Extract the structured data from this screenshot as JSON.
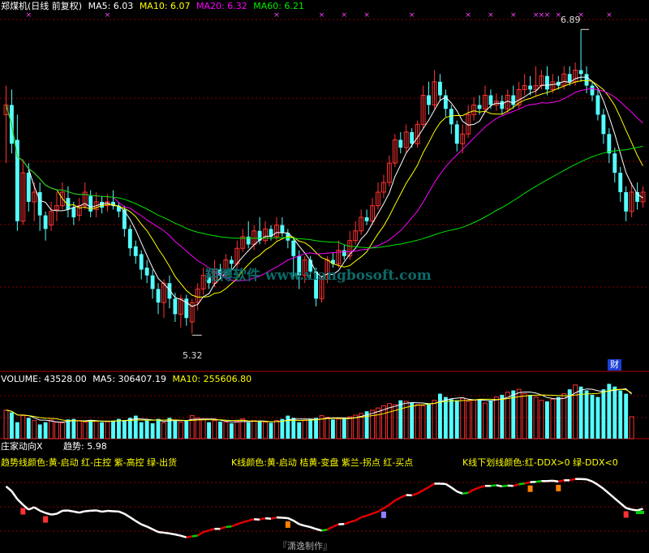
{
  "header": {
    "stock": "郑煤机(日线 前复权)",
    "ma5": "MA5: 6.03",
    "ma10": "MA10: 6.07",
    "ma20": "MA20: 6.32",
    "ma60": "MA60: 6.21"
  },
  "price_annotations": {
    "high": "6.89",
    "low": "5.32"
  },
  "watermark": "翔博软件 www.xiangbosoft.com",
  "badge_cai": "财",
  "volume_header": {
    "title": "VOLUME: 43528.00",
    "ma5": "MA5: 306407.19",
    "ma10": "MA10: 255606.80"
  },
  "indicator_header": {
    "name": "庄家动向X",
    "trend": "趋势: 5.98",
    "legend1": "趋势线颜色:黄-启动 红-庄控 紫-高控 绿-出货",
    "legend2": "K线颜色:黄-启动 桔黄-变盘 紫兰-拐点 红-买点",
    "legend3": "K线下划线颜色:红-DDX>0 绿-DDX<0"
  },
  "credit": "『潇逸制作』",
  "colors": {
    "up": "#ff3232",
    "down": "#54ffff",
    "ma5": "#ffffff",
    "ma10": "#ffff00",
    "ma20": "#ff00ff",
    "ma60": "#00e600",
    "grid": "#8a0000",
    "border": "#b40000",
    "text_gold": "#ffff00",
    "text_white": "#ffffff"
  },
  "chart_data": [
    {
      "type": "candlestick",
      "title": "郑煤机(日线 前复权)",
      "ylim": [
        5.2,
        6.95
      ],
      "annotations": [
        {
          "label": "6.89",
          "kind": "high"
        },
        {
          "label": "5.32",
          "kind": "low"
        }
      ],
      "candles": [
        [
          6.45,
          6.5,
          6.6,
          6.2
        ],
        [
          6.5,
          6.3,
          6.58,
          6.25
        ],
        [
          6.32,
          5.9,
          6.45,
          5.85
        ],
        [
          5.9,
          6.15,
          6.22,
          5.88
        ],
        [
          6.15,
          6.0,
          6.2,
          5.95
        ],
        [
          6.0,
          6.05,
          6.1,
          5.9
        ],
        [
          6.05,
          5.93,
          6.1,
          5.85
        ],
        [
          5.93,
          5.86,
          5.95,
          5.8
        ],
        [
          5.88,
          5.95,
          6.0,
          5.85
        ],
        [
          5.96,
          5.98,
          6.05,
          5.9
        ],
        [
          5.98,
          6.05,
          6.1,
          5.96
        ],
        [
          6.02,
          5.96,
          6.08,
          5.92
        ],
        [
          5.97,
          5.92,
          6.0,
          5.88
        ],
        [
          5.93,
          5.98,
          6.02,
          5.9
        ],
        [
          5.98,
          6.05,
          6.1,
          5.96
        ],
        [
          6.03,
          5.95,
          6.06,
          5.92
        ],
        [
          5.96,
          6.0,
          6.05,
          5.92
        ],
        [
          6.0,
          5.97,
          6.03,
          5.94
        ],
        [
          5.98,
          6.0,
          6.04,
          5.95
        ],
        [
          6.0,
          5.98,
          6.06,
          5.96
        ],
        [
          5.98,
          5.95,
          6.0,
          5.92
        ],
        [
          5.96,
          5.86,
          5.98,
          5.82
        ],
        [
          5.86,
          5.76,
          5.88,
          5.72
        ],
        [
          5.77,
          5.72,
          5.8,
          5.68
        ],
        [
          5.73,
          5.65,
          5.75,
          5.6
        ],
        [
          5.66,
          5.62,
          5.7,
          5.58
        ],
        [
          5.62,
          5.55,
          5.65,
          5.5
        ],
        [
          5.55,
          5.48,
          5.58,
          5.42
        ],
        [
          5.48,
          5.58,
          5.6,
          5.4
        ],
        [
          5.58,
          5.5,
          5.62,
          5.45
        ],
        [
          5.5,
          5.42,
          5.53,
          5.38
        ],
        [
          5.42,
          5.5,
          5.52,
          5.35
        ],
        [
          5.5,
          5.4,
          5.52,
          5.36
        ],
        [
          5.38,
          5.48,
          5.5,
          5.32
        ],
        [
          5.48,
          5.55,
          5.58,
          5.44
        ],
        [
          5.55,
          5.62,
          5.66,
          5.52
        ],
        [
          5.62,
          5.58,
          5.65,
          5.55
        ],
        [
          5.58,
          5.65,
          5.7,
          5.56
        ],
        [
          5.65,
          5.62,
          5.68,
          5.6
        ],
        [
          5.62,
          5.7,
          5.73,
          5.6
        ],
        [
          5.7,
          5.68,
          5.72,
          5.65
        ],
        [
          5.68,
          5.76,
          5.8,
          5.66
        ],
        [
          5.76,
          5.82,
          5.86,
          5.74
        ],
        [
          5.82,
          5.78,
          5.9,
          5.76
        ],
        [
          5.78,
          5.85,
          5.88,
          5.75
        ],
        [
          5.85,
          5.8,
          5.92,
          5.78
        ],
        [
          5.8,
          5.86,
          5.9,
          5.78
        ],
        [
          5.86,
          5.82,
          5.88,
          5.8
        ],
        [
          5.82,
          5.88,
          5.92,
          5.8
        ],
        [
          5.88,
          5.84,
          5.92,
          5.82
        ],
        [
          5.84,
          5.8,
          5.86,
          5.76
        ],
        [
          5.8,
          5.72,
          5.82,
          5.6
        ],
        [
          5.72,
          5.62,
          5.75,
          5.55
        ],
        [
          5.62,
          5.7,
          5.72,
          5.58
        ],
        [
          5.7,
          5.64,
          5.72,
          5.6
        ],
        [
          5.64,
          5.5,
          5.66,
          5.46
        ],
        [
          5.5,
          5.6,
          5.62,
          5.48
        ],
        [
          5.6,
          5.7,
          5.72,
          5.58
        ],
        [
          5.7,
          5.68,
          5.74,
          5.66
        ],
        [
          5.68,
          5.75,
          5.8,
          5.66
        ],
        [
          5.75,
          5.72,
          5.78,
          5.7
        ],
        [
          5.72,
          5.8,
          5.85,
          5.7
        ],
        [
          5.8,
          5.85,
          5.9,
          5.78
        ],
        [
          5.85,
          5.92,
          5.96,
          5.83
        ],
        [
          5.92,
          5.9,
          5.96,
          5.88
        ],
        [
          5.9,
          5.98,
          6.02,
          5.88
        ],
        [
          5.98,
          6.05,
          6.1,
          5.96
        ],
        [
          6.05,
          6.1,
          6.14,
          6.02
        ],
        [
          6.1,
          6.2,
          6.24,
          6.08
        ],
        [
          6.2,
          6.32,
          6.35,
          6.18
        ],
        [
          6.32,
          6.28,
          6.36,
          6.25
        ],
        [
          6.28,
          6.36,
          6.4,
          6.25
        ],
        [
          6.36,
          6.3,
          6.38,
          6.28
        ],
        [
          6.3,
          6.4,
          6.42,
          6.28
        ],
        [
          6.4,
          6.55,
          6.6,
          6.38
        ],
        [
          6.55,
          6.5,
          6.62,
          6.45
        ],
        [
          6.5,
          6.62,
          6.68,
          6.48
        ],
        [
          6.62,
          6.55,
          6.66,
          6.52
        ],
        [
          6.55,
          6.48,
          6.58,
          6.44
        ],
        [
          6.48,
          6.4,
          6.5,
          6.35
        ],
        [
          6.4,
          6.3,
          6.42,
          6.26
        ],
        [
          6.3,
          6.35,
          6.4,
          6.25
        ],
        [
          6.35,
          6.45,
          6.5,
          6.33
        ],
        [
          6.45,
          6.5,
          6.54,
          6.42
        ],
        [
          6.5,
          6.48,
          6.55,
          6.45
        ],
        [
          6.48,
          6.55,
          6.6,
          6.46
        ],
        [
          6.55,
          6.5,
          6.58,
          6.48
        ],
        [
          6.5,
          6.52,
          6.56,
          6.47
        ],
        [
          6.52,
          6.48,
          6.55,
          6.45
        ],
        [
          6.48,
          6.55,
          6.58,
          6.46
        ],
        [
          6.55,
          6.5,
          6.6,
          6.48
        ],
        [
          6.5,
          6.58,
          6.62,
          6.48
        ],
        [
          6.58,
          6.6,
          6.66,
          6.55
        ],
        [
          6.6,
          6.58,
          6.65,
          6.55
        ],
        [
          6.58,
          6.6,
          6.7,
          6.55
        ],
        [
          6.6,
          6.65,
          6.68,
          6.58
        ],
        [
          6.65,
          6.58,
          6.7,
          6.55
        ],
        [
          6.58,
          6.62,
          6.66,
          6.56
        ],
        [
          6.62,
          6.6,
          6.65,
          6.58
        ],
        [
          6.6,
          6.66,
          6.7,
          6.58
        ],
        [
          6.66,
          6.62,
          6.7,
          6.6
        ],
        [
          6.62,
          6.68,
          6.72,
          6.6
        ],
        [
          6.68,
          6.66,
          6.89,
          6.62
        ],
        [
          6.66,
          6.6,
          6.7,
          6.56
        ],
        [
          6.6,
          6.55,
          6.62,
          6.52
        ],
        [
          6.55,
          6.45,
          6.58,
          6.42
        ],
        [
          6.45,
          6.35,
          6.48,
          6.3
        ],
        [
          6.35,
          6.25,
          6.38,
          6.2
        ],
        [
          6.25,
          6.15,
          6.28,
          6.1
        ],
        [
          6.15,
          6.05,
          6.18,
          6.0
        ],
        [
          6.05,
          5.95,
          6.08,
          5.9
        ],
        [
          5.95,
          6.05,
          6.1,
          5.92
        ],
        [
          6.05,
          6.0,
          6.1,
          5.96
        ],
        [
          6.0,
          6.05,
          6.08,
          5.97
        ]
      ]
    },
    {
      "type": "bar",
      "title": "VOLUME",
      "values": [
        520,
        480,
        300,
        420,
        380,
        330,
        260,
        300,
        340,
        300,
        290,
        350,
        360,
        330,
        300,
        340,
        320,
        300,
        310,
        330,
        360,
        340,
        380,
        420,
        300,
        330,
        280,
        360,
        290,
        380,
        330,
        300,
        340,
        420,
        380,
        360,
        300,
        330,
        310,
        300,
        280,
        320,
        360,
        300,
        330,
        310,
        300,
        290,
        330,
        360,
        420,
        380,
        300,
        330,
        360,
        380,
        420,
        390,
        350,
        360,
        380,
        400,
        430,
        460,
        500,
        520,
        560,
        600,
        640,
        620,
        700,
        680,
        650,
        620,
        600,
        640,
        700,
        820,
        760,
        720,
        700,
        740,
        680,
        700,
        720,
        650,
        700,
        760,
        800,
        850,
        880,
        900,
        820,
        800,
        760,
        700,
        680,
        720,
        760,
        820,
        900,
        980,
        950,
        880,
        800,
        760,
        900,
        1000,
        950,
        880,
        820,
        400
      ]
    },
    {
      "type": "line",
      "title": "庄家动向X",
      "series": [
        {
          "name": "趋势",
          "values": [
            5.98
          ]
        }
      ]
    }
  ]
}
